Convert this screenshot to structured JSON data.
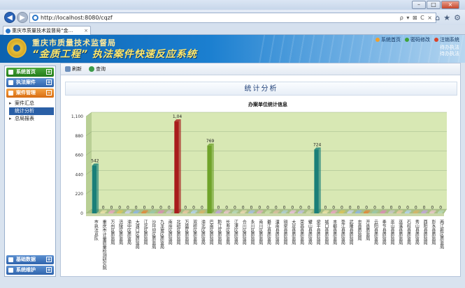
{
  "browser": {
    "url": "http://localhost:8080/cqzf",
    "tab_title": "重庆市质量技术监督局“金...",
    "tab_close": "×",
    "back_icon": "arrow-left-icon",
    "forward_icon": "arrow-right-icon",
    "address_tools": "ρ ▾ ⊠ C ×",
    "minimize": "–",
    "maximize": "□",
    "close": "×"
  },
  "header": {
    "org_name": "重庆市质量技术监督局",
    "system_name": "“金质工程” 执法案件快速反应系统",
    "links": [
      {
        "label": "系统首页",
        "color": "#f2a02a"
      },
      {
        "label": "密码修改",
        "color": "#3fa33a"
      },
      {
        "label": "注销系统",
        "color": "#d9432a"
      }
    ],
    "stats": [
      "待办执法",
      "待办执法"
    ]
  },
  "sidebar": {
    "sections": [
      {
        "label": "系统首页",
        "color": "green",
        "toggle": "+"
      },
      {
        "label": "执法案件",
        "color": "blue",
        "toggle": "+"
      },
      {
        "label": "案件管理",
        "color": "orange",
        "toggle": "–"
      }
    ],
    "items": [
      {
        "label": "案件汇总",
        "arrow": true,
        "active": false
      },
      {
        "label": "统计分析",
        "arrow": false,
        "active": true
      },
      {
        "label": "总局报表",
        "arrow": true,
        "active": false
      }
    ],
    "bottom_sections": [
      {
        "label": "基础数据",
        "color": "blue",
        "toggle": "+"
      },
      {
        "label": "系统维护",
        "color": "blue",
        "toggle": "+"
      }
    ]
  },
  "toolbar": {
    "refresh_label": "刷新",
    "query_label": "查询"
  },
  "panel": {
    "title": "统计分析"
  },
  "chart_data": {
    "type": "bar",
    "title": "办案单位统计信息",
    "ylim": [
      0,
      1100
    ],
    "yticks": [
      0,
      220,
      440,
      660,
      880,
      "1,100"
    ],
    "grid": true,
    "categories": [
      "市执法总队",
      "重庆市计量质量检测研究院",
      "万州区质监局",
      "涪陵区质监局",
      "渝中区质监局",
      "大渡口区质监局",
      "江北区质监局",
      "沙坪坝区质监局",
      "九龙坡区质监局",
      "南岸区质监局",
      "北碚区质监局",
      "万盛区质监局",
      "双桥区质监局",
      "渝北区质监局",
      "巴南区质监局",
      "黔江区质监局",
      "长寿区质监局",
      "江津区质监局",
      "合川区质监局",
      "永川区质监局",
      "南川区质监局",
      "綦江县质监局",
      "潼南县质监局",
      "铜梁县质监局",
      "大足县质监局",
      "荣昌县质监局",
      "璧山县质监局",
      "梁平县质监局",
      "城口县质监局",
      "丰都县质监局",
      "垫江县质监局",
      "武隆县质监局",
      "忠县质监局",
      "开县质监局",
      "云阳县质监局",
      "奉节县质监局",
      "巫山县质监局",
      "巫溪县质监局",
      "石柱县质监局",
      "秀山县质监局",
      "酉阳县质监局",
      "彭水县质监局",
      "两江新区质监局"
    ],
    "values": [
      542,
      0,
      0,
      0,
      0,
      0,
      0,
      0,
      0,
      0,
      1044,
      0,
      0,
      0,
      769,
      0,
      0,
      0,
      0,
      0,
      0,
      0,
      0,
      0,
      0,
      0,
      0,
      724,
      0,
      0,
      0,
      0,
      0,
      0,
      0,
      0,
      0,
      0,
      0,
      0,
      0,
      0,
      0
    ],
    "value_labels": [
      "542",
      "0",
      "0",
      "0",
      "0",
      "0",
      "0",
      "0",
      "0",
      "0",
      "1,04",
      "0",
      "0",
      "0",
      "769",
      "0",
      "0",
      "0",
      "0",
      "0",
      "0",
      "0",
      "0",
      "0",
      "0",
      "0",
      "0",
      "724",
      "0",
      "0",
      "0",
      "0",
      "0",
      "0",
      "0",
      "0",
      "0",
      "0",
      "0",
      "0",
      "0",
      "0",
      "0"
    ],
    "bar_colors": [
      "#1a7f78",
      "#e9e2a8",
      "#e7a7c1",
      "#d9c45a",
      "#c9d3ea",
      "#8fb8e0",
      "#e08a3c",
      "#9bc8a8",
      "#d88fb4",
      "#c7c7c7",
      "#a81c1c",
      "#e7c8a0",
      "#b4d4e8",
      "#d4b56a",
      "#6fa32a",
      "#c0a8d8",
      "#e7c8c8",
      "#b8d8b8",
      "#e8d8b0",
      "#a8c0e0",
      "#e0b0c0",
      "#c8e0a8",
      "#d8c0a0",
      "#b0d0d0",
      "#e8c0d8",
      "#c0c0e0",
      "#d0d8a8",
      "#1a7f78",
      "#e9e2a8",
      "#e7a7c1",
      "#d9c45a",
      "#c9d3ea",
      "#8fb8e0",
      "#e08a3c",
      "#9bc8a8",
      "#d88fb4",
      "#c7c7c7",
      "#e7c8a0",
      "#b4d4e8",
      "#d4b56a",
      "#c0a8d8",
      "#e7c8c8",
      "#b8d8b8"
    ]
  }
}
